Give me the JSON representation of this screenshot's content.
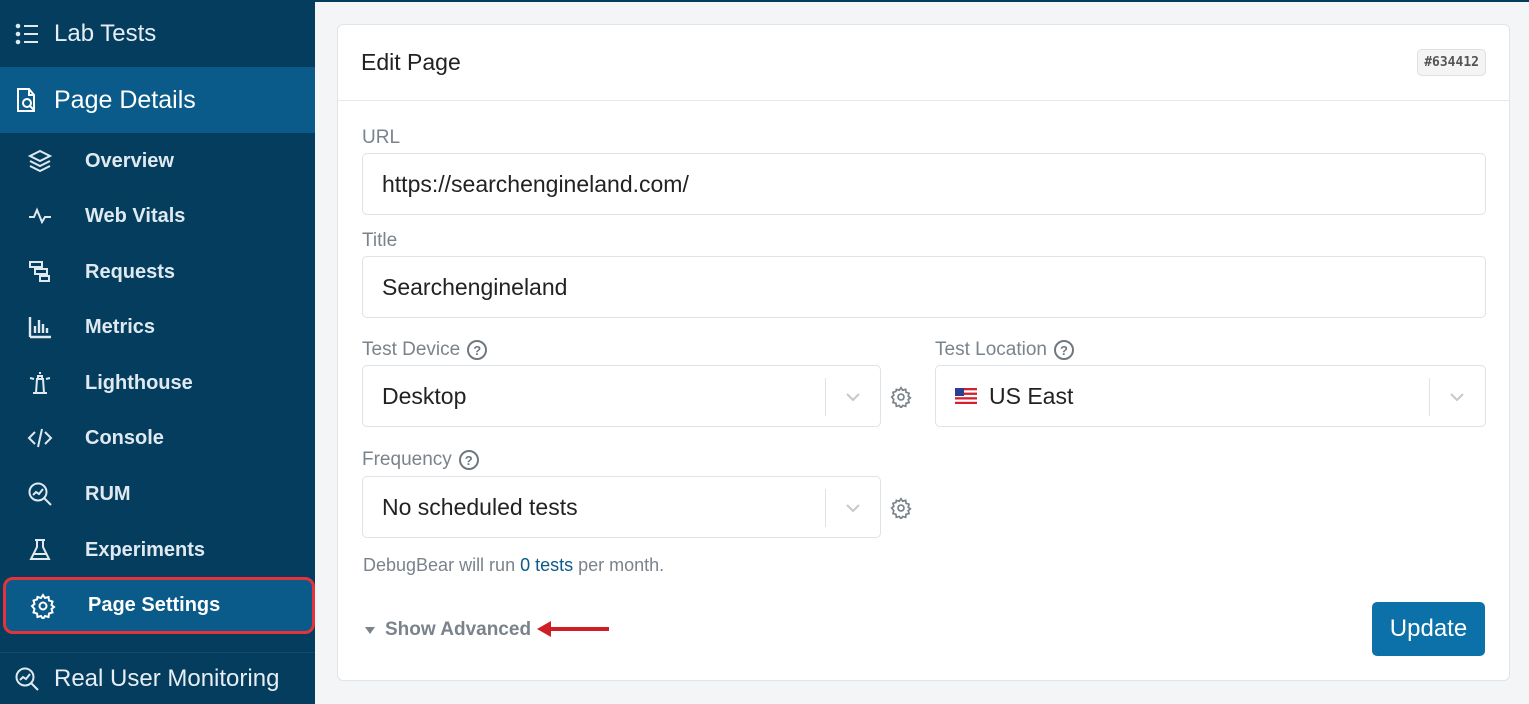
{
  "sidebar": {
    "top_label": "Lab Tests",
    "active_section": "Page Details",
    "items": [
      {
        "label": "Overview",
        "icon": "layers-icon"
      },
      {
        "label": "Web Vitals",
        "icon": "pulse-icon"
      },
      {
        "label": "Requests",
        "icon": "waterfall-icon"
      },
      {
        "label": "Metrics",
        "icon": "bar-chart-icon"
      },
      {
        "label": "Lighthouse",
        "icon": "lighthouse-icon"
      },
      {
        "label": "Console",
        "icon": "code-icon"
      },
      {
        "label": "RUM",
        "icon": "search-chart-icon"
      },
      {
        "label": "Experiments",
        "icon": "flask-icon"
      },
      {
        "label": "Page Settings",
        "icon": "gear-icon"
      }
    ],
    "bottom_label": "Real User Monitoring"
  },
  "card": {
    "title": "Edit Page",
    "page_id": "#634412"
  },
  "form": {
    "url_label": "URL",
    "url_value": "https://searchengineland.com/",
    "title_label": "Title",
    "title_value": "Searchengineland",
    "device_label": "Test Device",
    "device_value": "Desktop",
    "location_label": "Test Location",
    "location_value": "US East",
    "frequency_label": "Frequency",
    "frequency_value": "No scheduled tests",
    "info_prefix": "DebugBear will run ",
    "info_link": "0 tests",
    "info_suffix": " per month.",
    "advanced_label": "Show Advanced",
    "update_label": "Update",
    "help_glyph": "?"
  },
  "colors": {
    "sidebar_bg": "#053d5e",
    "sidebar_active": "#0a5b89",
    "highlight_border": "#e5333b",
    "primary_button": "#0b71a8"
  }
}
